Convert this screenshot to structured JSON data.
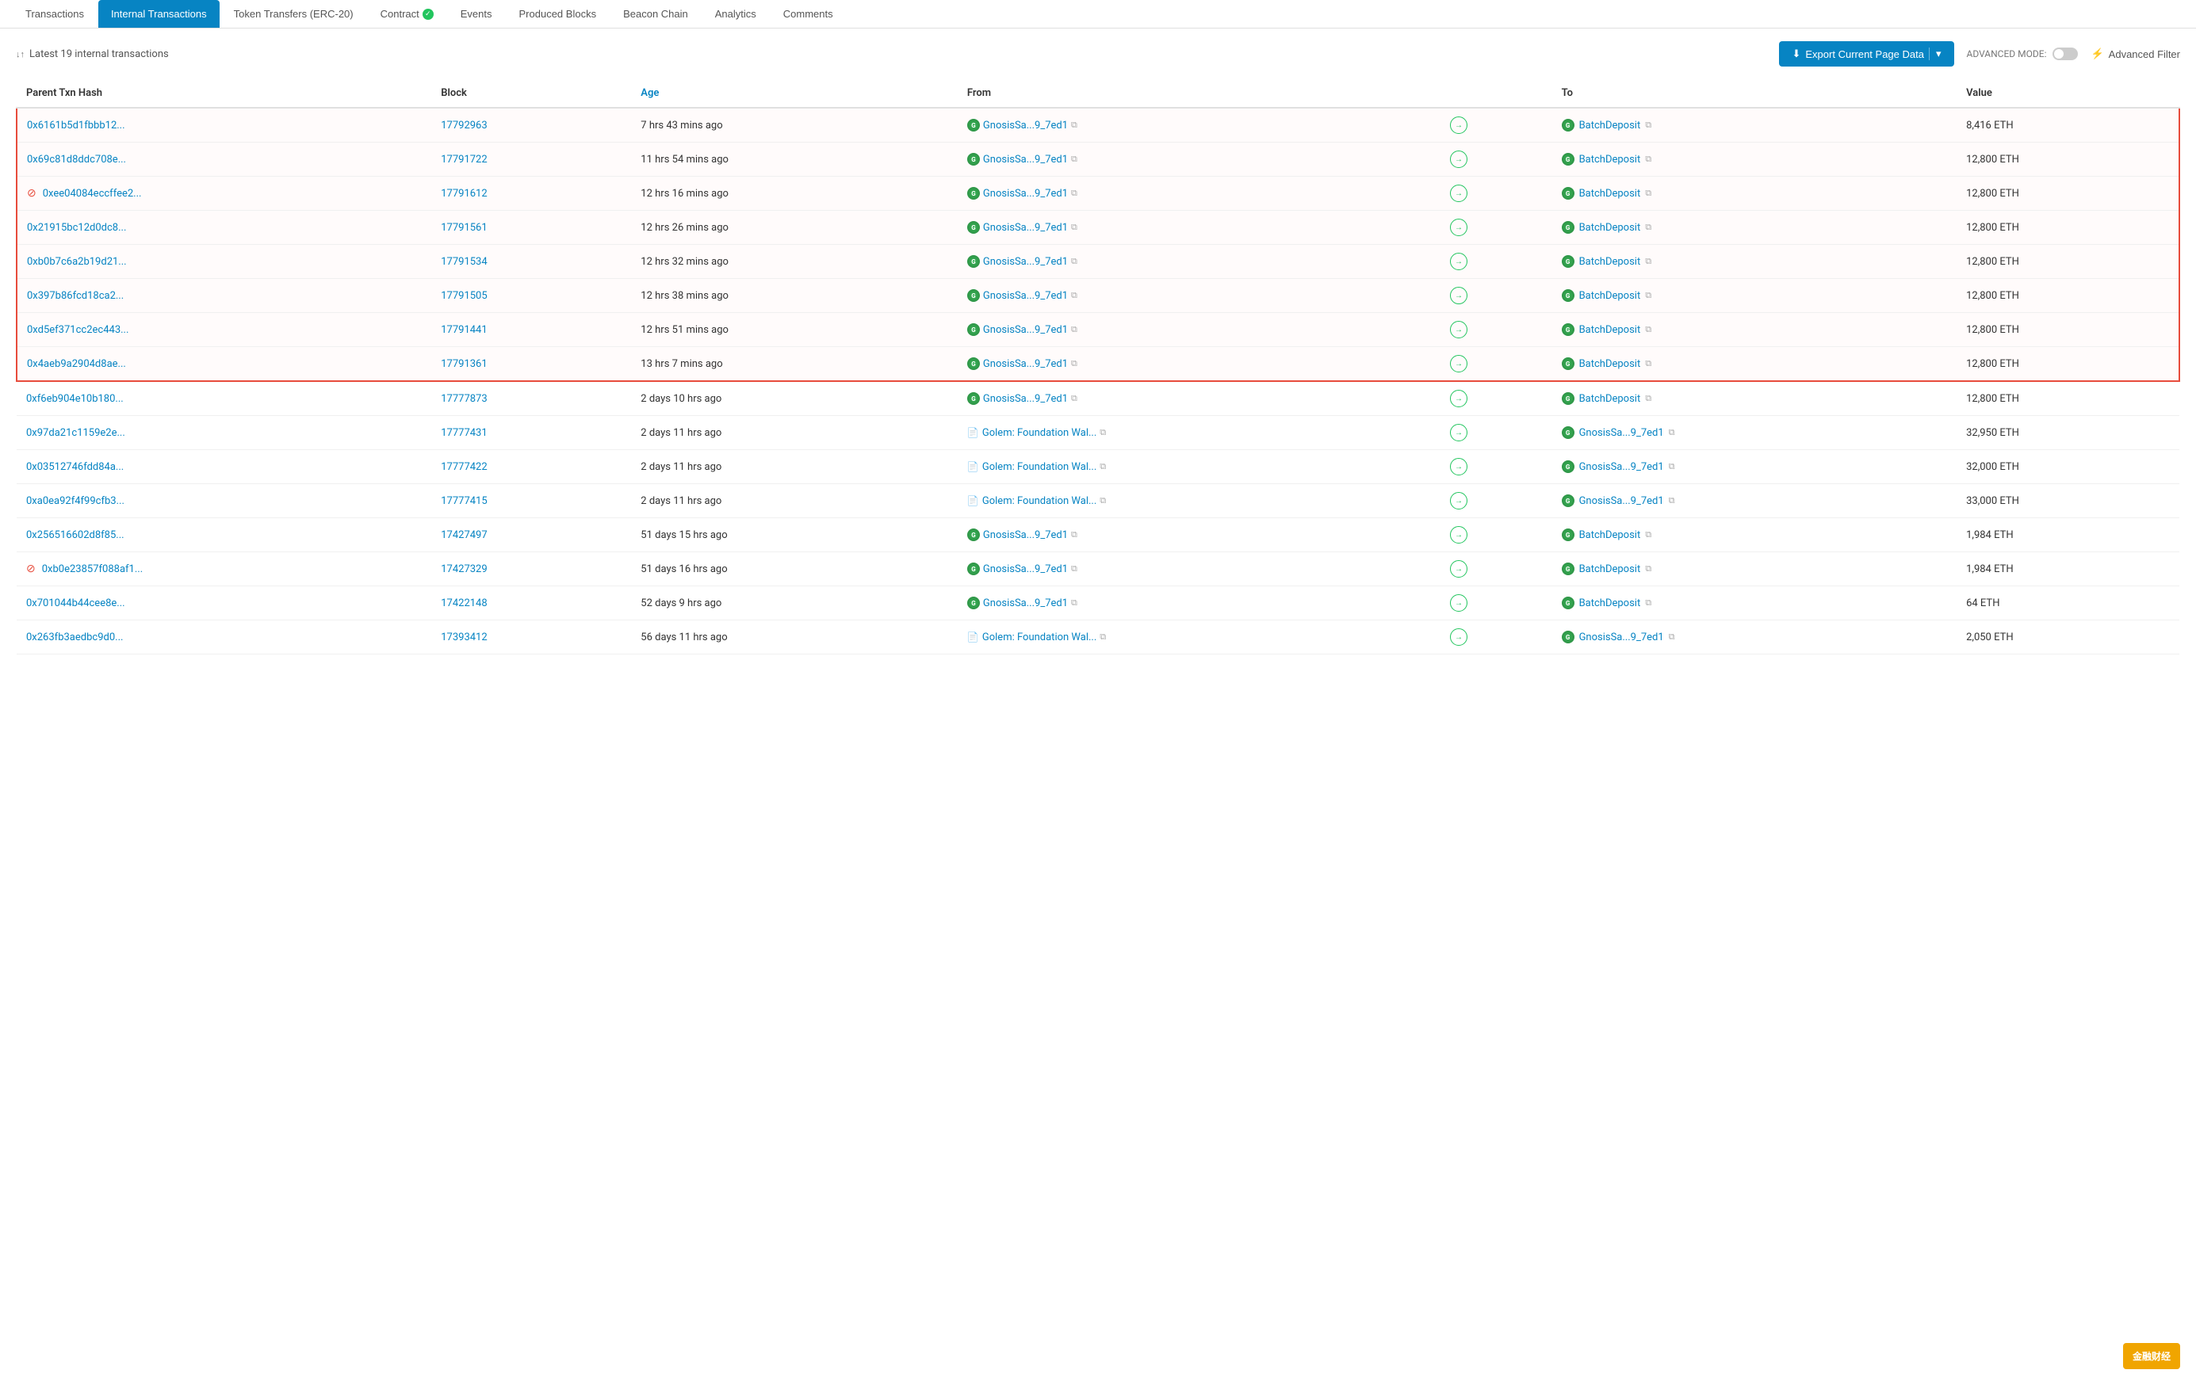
{
  "tabs": [
    {
      "label": "Transactions",
      "active": false
    },
    {
      "label": "Internal Transactions",
      "active": true
    },
    {
      "label": "Token Transfers (ERC-20)",
      "active": false
    },
    {
      "label": "Contract",
      "active": false,
      "verified": true
    },
    {
      "label": "Events",
      "active": false
    },
    {
      "label": "Produced Blocks",
      "active": false
    },
    {
      "label": "Beacon Chain",
      "active": false
    },
    {
      "label": "Analytics",
      "active": false
    },
    {
      "label": "Comments",
      "active": false
    }
  ],
  "toolbar": {
    "sort_icon": "↓↑",
    "summary": "Latest 19 internal transactions",
    "export_label": "Export Current Page Data",
    "advanced_mode_label": "ADVANCED MODE:",
    "advanced_filter_label": "Advanced Filter"
  },
  "table": {
    "columns": [
      "Parent Txn Hash",
      "Block",
      "Age",
      "From",
      "To",
      "Value"
    ],
    "age_col_index": 2,
    "rows": [
      {
        "hash": "0x6161b5d1fbbb12...",
        "block": "17792963",
        "age": "7 hrs 43 mins ago",
        "from_icon": "gnosis",
        "from": "GnosisSa...9_7ed1",
        "to_icon": "gnosis",
        "to": "BatchDeposit",
        "value": "8,416 ETH",
        "highlighted": true,
        "error": false
      },
      {
        "hash": "0x69c81d8ddc708e...",
        "block": "17791722",
        "age": "11 hrs 54 mins ago",
        "from_icon": "gnosis",
        "from": "GnosisSa...9_7ed1",
        "to_icon": "gnosis",
        "to": "BatchDeposit",
        "value": "12,800 ETH",
        "highlighted": true,
        "error": false
      },
      {
        "hash": "0xee04084eccffee2...",
        "block": "17791612",
        "age": "12 hrs 16 mins ago",
        "from_icon": "gnosis",
        "from": "GnosisSa...9_7ed1",
        "to_icon": "gnosis",
        "to": "BatchDeposit",
        "value": "12,800 ETH",
        "highlighted": true,
        "error": true
      },
      {
        "hash": "0x21915bc12d0dc8...",
        "block": "17791561",
        "age": "12 hrs 26 mins ago",
        "from_icon": "gnosis",
        "from": "GnosisSa...9_7ed1",
        "to_icon": "gnosis",
        "to": "BatchDeposit",
        "value": "12,800 ETH",
        "highlighted": true,
        "error": false
      },
      {
        "hash": "0xb0b7c6a2b19d21...",
        "block": "17791534",
        "age": "12 hrs 32 mins ago",
        "from_icon": "gnosis",
        "from": "GnosisSa...9_7ed1",
        "to_icon": "gnosis",
        "to": "BatchDeposit",
        "value": "12,800 ETH",
        "highlighted": true,
        "error": false
      },
      {
        "hash": "0x397b86fcd18ca2...",
        "block": "17791505",
        "age": "12 hrs 38 mins ago",
        "from_icon": "gnosis",
        "from": "GnosisSa...9_7ed1",
        "to_icon": "gnosis",
        "to": "BatchDeposit",
        "value": "12,800 ETH",
        "highlighted": true,
        "error": false
      },
      {
        "hash": "0xd5ef371cc2ec443...",
        "block": "17791441",
        "age": "12 hrs 51 mins ago",
        "from_icon": "gnosis",
        "from": "GnosisSa...9_7ed1",
        "to_icon": "gnosis",
        "to": "BatchDeposit",
        "value": "12,800 ETH",
        "highlighted": true,
        "error": false
      },
      {
        "hash": "0x4aeb9a2904d8ae...",
        "block": "17791361",
        "age": "13 hrs 7 mins ago",
        "from_icon": "gnosis",
        "from": "GnosisSa...9_7ed1",
        "to_icon": "gnosis",
        "to": "BatchDeposit",
        "value": "12,800 ETH",
        "highlighted": true,
        "error": false
      },
      {
        "hash": "0xf6eb904e10b180...",
        "block": "17777873",
        "age": "2 days 10 hrs ago",
        "from_icon": "gnosis",
        "from": "GnosisSa...9_7ed1",
        "to_icon": "gnosis",
        "to": "BatchDeposit",
        "value": "12,800 ETH",
        "highlighted": false,
        "error": false
      },
      {
        "hash": "0x97da21c1159e2e...",
        "block": "17777431",
        "age": "2 days 11 hrs ago",
        "from_icon": "file",
        "from": "Golem: Foundation Wal...",
        "to_icon": "gnosis",
        "to": "GnosisSa...9_7ed1",
        "value": "32,950 ETH",
        "highlighted": false,
        "error": false
      },
      {
        "hash": "0x03512746fdd84a...",
        "block": "17777422",
        "age": "2 days 11 hrs ago",
        "from_icon": "file",
        "from": "Golem: Foundation Wal...",
        "to_icon": "gnosis",
        "to": "GnosisSa...9_7ed1",
        "value": "32,000 ETH",
        "highlighted": false,
        "error": false
      },
      {
        "hash": "0xa0ea92f4f99cfb3...",
        "block": "17777415",
        "age": "2 days 11 hrs ago",
        "from_icon": "file",
        "from": "Golem: Foundation Wal...",
        "to_icon": "gnosis",
        "to": "GnosisSa...9_7ed1",
        "value": "33,000 ETH",
        "highlighted": false,
        "error": false
      },
      {
        "hash": "0x256516602d8f85...",
        "block": "17427497",
        "age": "51 days 15 hrs ago",
        "from_icon": "gnosis",
        "from": "GnosisSa...9_7ed1",
        "to_icon": "gnosis",
        "to": "BatchDeposit",
        "value": "1,984 ETH",
        "highlighted": false,
        "error": false
      },
      {
        "hash": "0xb0e23857f088af1...",
        "block": "17427329",
        "age": "51 days 16 hrs ago",
        "from_icon": "gnosis",
        "from": "GnosisSa...9_7ed1",
        "to_icon": "gnosis",
        "to": "BatchDeposit",
        "value": "1,984 ETH",
        "highlighted": false,
        "error": true
      },
      {
        "hash": "0x701044b44cee8e...",
        "block": "17422148",
        "age": "52 days 9 hrs ago",
        "from_icon": "gnosis",
        "from": "GnosisSa...9_7ed1",
        "to_icon": "gnosis",
        "to": "BatchDeposit",
        "value": "64 ETH",
        "highlighted": false,
        "error": false
      },
      {
        "hash": "0x263fb3aedbc9d0...",
        "block": "17393412",
        "age": "56 days 11 hrs ago",
        "from_icon": "file",
        "from": "Golem: Foundation Wal...",
        "to_icon": "gnosis",
        "to": "GnosisSa...9_7ed1",
        "value": "2,050 ETH",
        "highlighted": false,
        "error": false
      }
    ]
  },
  "watermark": "金融财经"
}
